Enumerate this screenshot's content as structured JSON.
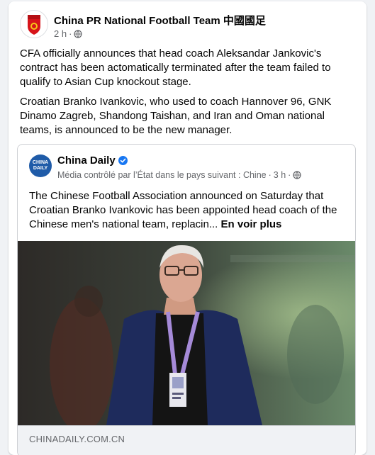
{
  "post": {
    "page_name": "China PR National Football Team 中國國足",
    "time": "2 h",
    "separator": "·",
    "audience_icon": "globe-icon",
    "paragraphs": [
      "CFA officially announces that head coach Aleksandar Jankovic's contract has been actomatically terminated after the team failed to qualify to Asian Cup knockout stage.",
      "Croatian Branko Ivankovic, who used to coach Hannover 96, GNK Dinamo Zagreb, Shandong Taishan, and Iran and Oman national teams, is announced to be the new manager."
    ]
  },
  "shared": {
    "logo_lines": [
      "CHINA",
      "DAILY"
    ],
    "name": "China Daily",
    "verified_icon": "verified-badge-icon",
    "state_label": "Média contrôlé par l’État dans le pays suivant : Chine",
    "separator": "·",
    "time": "3 h",
    "audience_icon": "globe-icon",
    "text": "The Chinese Football Association announced on Saturday that Croatian Branko Ivankovic has been appointed head coach of the Chinese men's national team, replacin...",
    "see_more": "En voir plus",
    "link_domain": "CHINADAILY.COM.CN"
  },
  "colors": {
    "verified": "#1877f2",
    "secondary_text": "#65676b",
    "china_daily_blue": "#1f5ba8",
    "cfa_red": "#d7141a"
  }
}
